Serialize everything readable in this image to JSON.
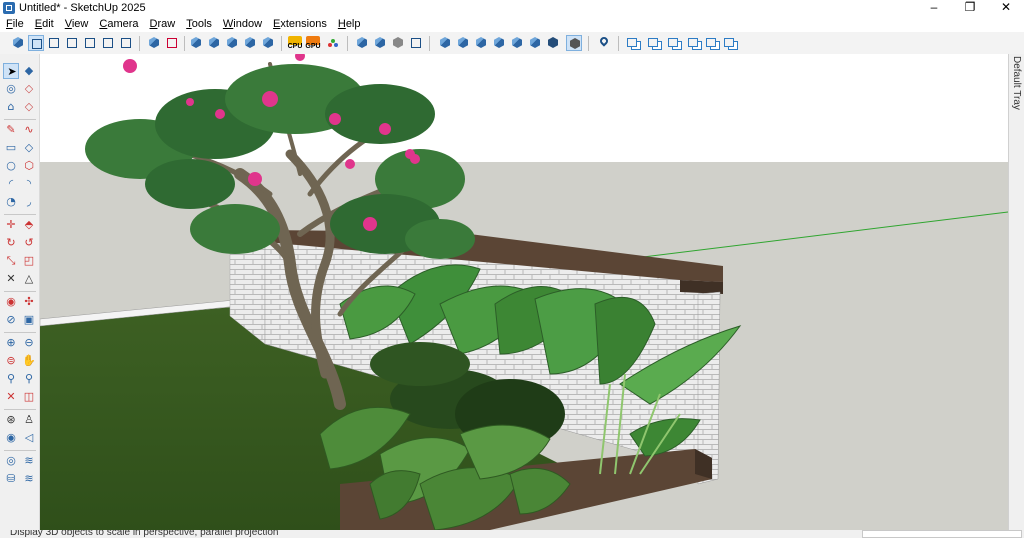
{
  "window": {
    "title": "Untitled* - SketchUp 2025",
    "minimize": "–",
    "maximize": "❐",
    "close": "✕"
  },
  "menu": [
    "File",
    "Edit",
    "View",
    "Camera",
    "Draw",
    "Tools",
    "Window",
    "Extensions",
    "Help"
  ],
  "toolbar": {
    "cpu_label": "CPU",
    "gpu_label": "GPU",
    "groups": [
      [
        "iso-view",
        "top-view",
        "front-view",
        "right-view",
        "back-view",
        "left-view"
      ],
      [
        "section-plane",
        "section-cut",
        "section-fill",
        "section-display",
        "x-ray",
        "back-edges"
      ],
      [
        "cpu",
        "gpu",
        "styles"
      ],
      [
        "component-browser",
        "material-browser",
        "extension-warehouse",
        "layout-send"
      ],
      [
        "shaded",
        "wireframe",
        "hidden-line",
        "shaded-textures",
        "monochrome",
        "textured",
        "style-mono",
        "style-shade"
      ],
      [
        "location"
      ],
      [
        "scene-1",
        "scene-2",
        "scene-3",
        "scene-4",
        "scene-5",
        "scene-6"
      ]
    ]
  },
  "palette": [
    [
      "select",
      "paint"
    ],
    [
      "eraser",
      "lasso"
    ],
    [
      "line",
      "freehand"
    ],
    [
      "rectangle",
      "rotated-rect"
    ],
    [
      "circle",
      "polygon"
    ],
    [
      "arc",
      "arc-2pt"
    ],
    [
      "pie",
      "arc-3pt"
    ],
    [
      "move",
      "push-pull"
    ],
    [
      "rotate",
      "follow-me"
    ],
    [
      "scale",
      "offset"
    ],
    [
      "tape-measure",
      "protractor"
    ],
    [
      "dimension",
      "text"
    ],
    [
      "axes",
      "3d-text"
    ],
    [
      "section-plane",
      "section-fill"
    ],
    [
      "orbit",
      "pan"
    ],
    [
      "zoom",
      "zoom-window"
    ],
    [
      "zoom-extents",
      "previous"
    ],
    [
      "walk",
      "position-camera"
    ],
    [
      "look-around",
      "position"
    ],
    [
      "geo",
      "sandbox"
    ],
    [
      "warehouse",
      "layers"
    ]
  ],
  "tray": {
    "label": "Default Tray"
  },
  "status": {
    "text": "Display 3D objects to scale in perspective, parallel projection"
  },
  "colors": {
    "sky": "#ffffff",
    "ground": "#d0d0ca",
    "lawn": "#3c5e22",
    "wall_brick": "#e8e8e8",
    "wall_cap": "#5b4535",
    "leaf": "#3f8f3a",
    "flower": "#e0358c",
    "axis_green": "#2fa52f"
  }
}
